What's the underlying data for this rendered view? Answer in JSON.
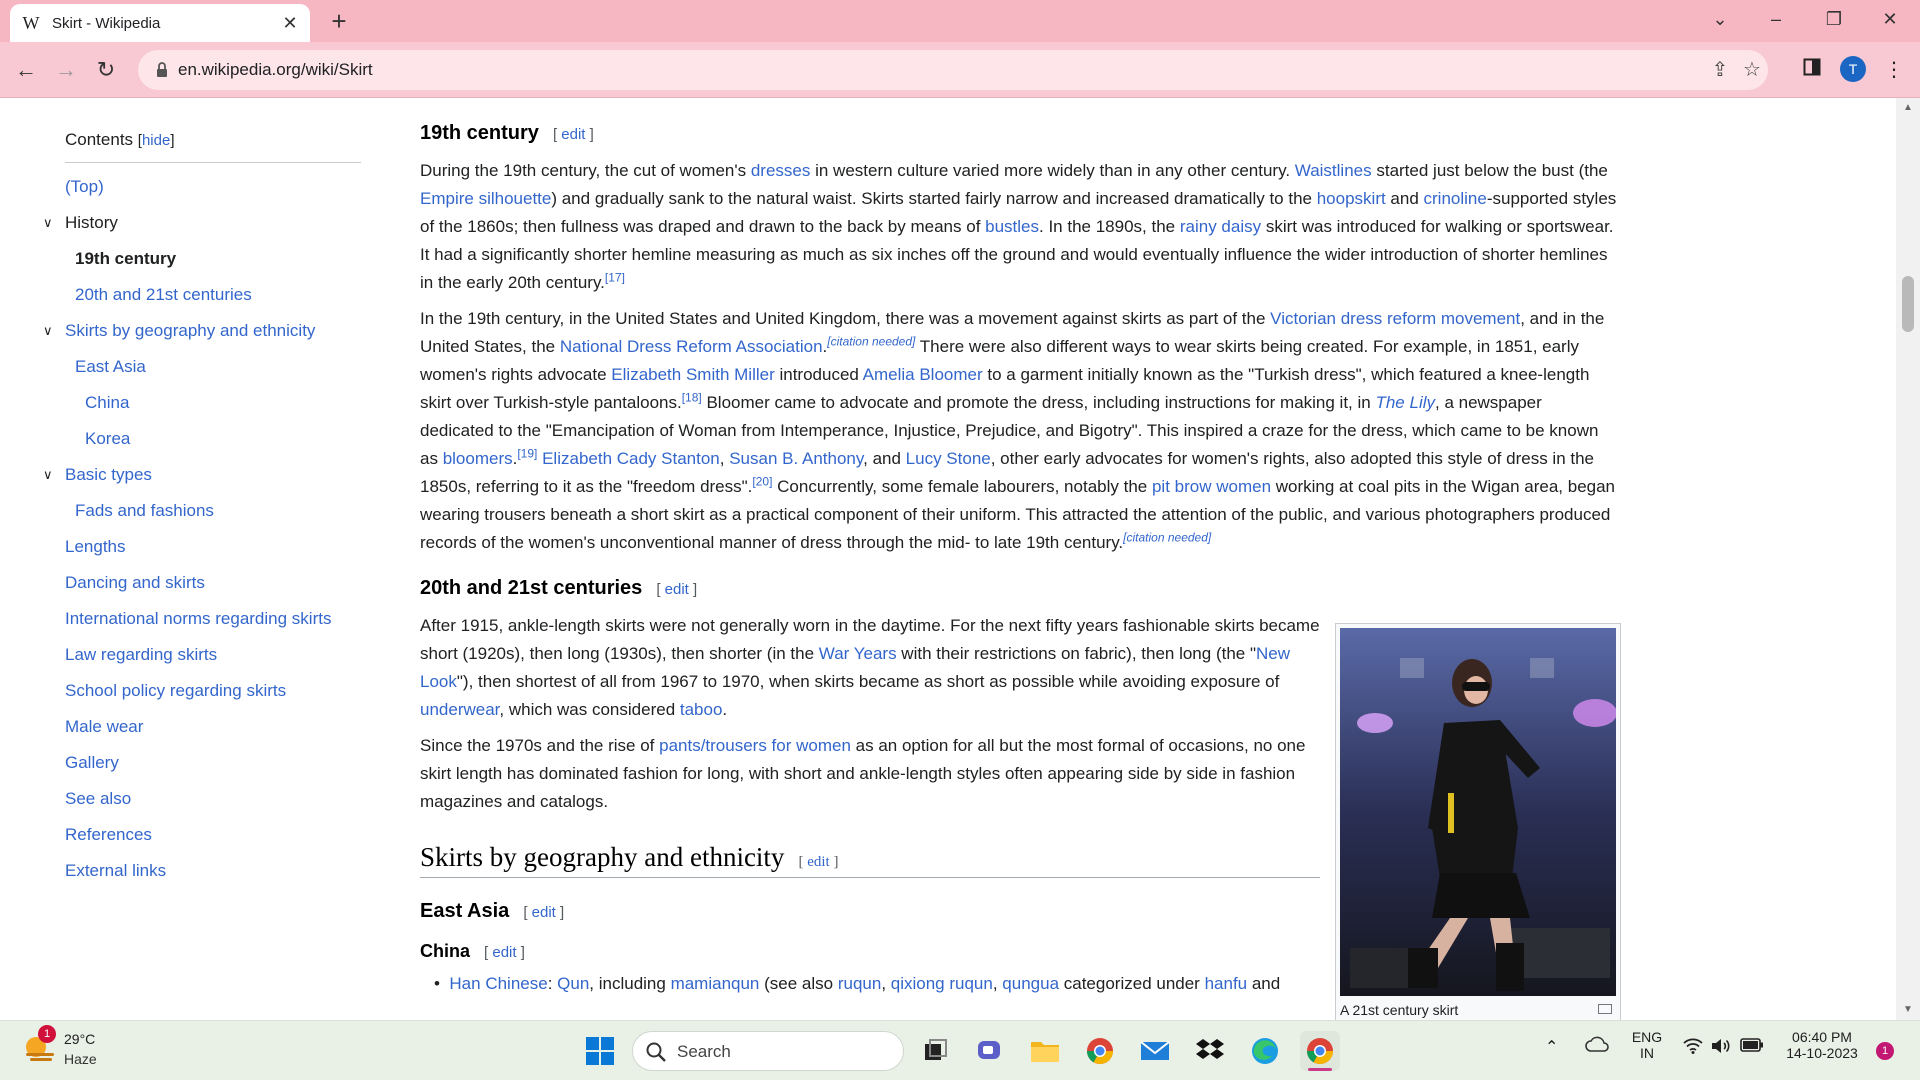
{
  "browser": {
    "tab_title": "Skirt - Wikipedia",
    "tab_favicon": "W",
    "url": "en.wikipedia.org/wiki/Skirt",
    "profile_initial": "T",
    "colors": {
      "tabstrip": "#f6b6c2",
      "toolbar": "#f8c9d2",
      "omnibox": "#fde5ea"
    }
  },
  "toc": {
    "title": "Contents",
    "hide_label": "hide",
    "items": [
      {
        "label": "(Top)"
      },
      {
        "label": "History"
      },
      {
        "label": "19th century"
      },
      {
        "label": "20th and 21st centuries"
      },
      {
        "label": "Skirts by geography and ethnicity"
      },
      {
        "label": "East Asia"
      },
      {
        "label": "China"
      },
      {
        "label": "Korea"
      },
      {
        "label": "Basic types"
      },
      {
        "label": "Fads and fashions"
      },
      {
        "label": "Lengths"
      },
      {
        "label": "Dancing and skirts"
      },
      {
        "label": "International norms regarding skirts"
      },
      {
        "label": "Law regarding skirts"
      },
      {
        "label": "School policy regarding skirts"
      },
      {
        "label": "Male wear"
      },
      {
        "label": "Gallery"
      },
      {
        "label": "See also"
      },
      {
        "label": "References"
      },
      {
        "label": "External links"
      }
    ]
  },
  "article": {
    "edit_label": "edit",
    "h_19th": "19th century",
    "h_20th": "20th and 21st centuries",
    "h_geo": "Skirts by geography and ethnicity",
    "h_eastasia": "East Asia",
    "h_china": "China",
    "p1": {
      "t1": "During the 19th century, the cut of women's ",
      "l1": "dresses",
      "t2": " in western culture varied more widely than in any other century. ",
      "l2": "Waistlines",
      "t3": " started just below the bust (the ",
      "l3": "Empire silhouette",
      "t4": ") and gradually sank to the natural waist. Skirts started fairly narrow and increased dramatically to the ",
      "l4": "hoopskirt",
      "t5": " and ",
      "l5": "crinoline",
      "t6": "-supported styles of the 1860s; then fullness was draped and drawn to the back by means of ",
      "l6": "bustles",
      "t7": ". In the 1890s, the ",
      "l7": "rainy daisy",
      "t8": " skirt was introduced for walking or sportswear. It had a significantly shorter hemline measuring as much as six inches off the ground and would eventually influence the wider introduction of shorter hemlines in the early 20th century.",
      "ref": "[17]"
    },
    "p2": {
      "t1": "In the 19th century, in the United States and United Kingdom, there was a movement against skirts as part of the ",
      "l1": "Victorian dress reform movement",
      "t2": ", and in the United States, the ",
      "l2": "National Dress Reform Association",
      "t3": ".",
      "cn1": "[citation needed]",
      "t4": " There were also different ways to wear skirts being created. For example, in 1851, early women's rights advocate ",
      "l3": "Elizabeth Smith Miller",
      "t5": " introduced ",
      "l4": "Amelia Bloomer",
      "t6": " to a garment initially known as the \"Turkish dress\", which featured a knee-length skirt over Turkish-style pantaloons.",
      "ref1": "[18]",
      "t7": " Bloomer came to advocate and promote the dress, including instructions for making it, in ",
      "l5": "The Lily",
      "t8": ", a newspaper dedicated to the \"Emancipation of Woman from Intemperance, Injustice, Prejudice, and Bigotry\". This inspired a craze for the dress, which came to be known as ",
      "l6": "bloomers",
      "t9": ".",
      "ref2": "[19]",
      "t10": " ",
      "l7": "Elizabeth Cady Stanton",
      "t11": ", ",
      "l8": "Susan B. Anthony",
      "t12": ", and ",
      "l9": "Lucy Stone",
      "t13": ", other early advocates for women's rights, also adopted this style of dress in the 1850s, referring to it as the \"freedom dress\".",
      "ref3": "[20]",
      "t14": " Concurrently, some female labourers, notably the ",
      "l10": "pit brow women",
      "t15": " working at coal pits in the Wigan area, began wearing trousers beneath a short skirt as a practical component of their uniform. This attracted the attention of the public, and various photographers produced records of the women's unconventional manner of dress through the mid- to late 19th century.",
      "cn2": "[citation needed]"
    },
    "p3": {
      "t1": "After 1915, ankle-length skirts were not generally worn in the daytime. For the next fifty years fashionable skirts became short (1920s), then long (1930s), then shorter (in the ",
      "l1": "War Years",
      "t2": " with their restrictions on fabric), then long (the \"",
      "l2": "New Look",
      "t3": "\"), then shortest of all from 1967 to 1970, when skirts became as short as possible while avoiding exposure of ",
      "l3": "underwear",
      "t4": ", which was considered ",
      "l4": "taboo",
      "t5": "."
    },
    "p4": {
      "t1": "Since the 1970s and the rise of ",
      "l1": "pants/trousers for women",
      "t2": " as an option for all but the most formal of occasions, no one skirt length has dominated fashion for long, with short and ankle-length styles often appearing side by side in fashion magazines and catalogs."
    },
    "china_item": {
      "l1": "Han Chinese",
      "t1": ": ",
      "l2": "Qun",
      "t2": ", including ",
      "l3": "mamianqun",
      "t3": " (see also ",
      "l4": "ruqun",
      "t4": ", ",
      "l5": "qixiong ruqun",
      "t5": ", ",
      "l6": "qungua",
      "t6": " categorized under ",
      "l7": "hanfu",
      "t7": " and"
    },
    "figure_caption": "A 21st century skirt"
  },
  "taskbar": {
    "weather_temp": "29°C",
    "weather_cond": "Haze",
    "weather_badge": "1",
    "search_label": "Search",
    "lang_top": "ENG",
    "lang_bottom": "IN",
    "time": "06:40 PM",
    "date": "14-10-2023",
    "notif_count": "1"
  }
}
